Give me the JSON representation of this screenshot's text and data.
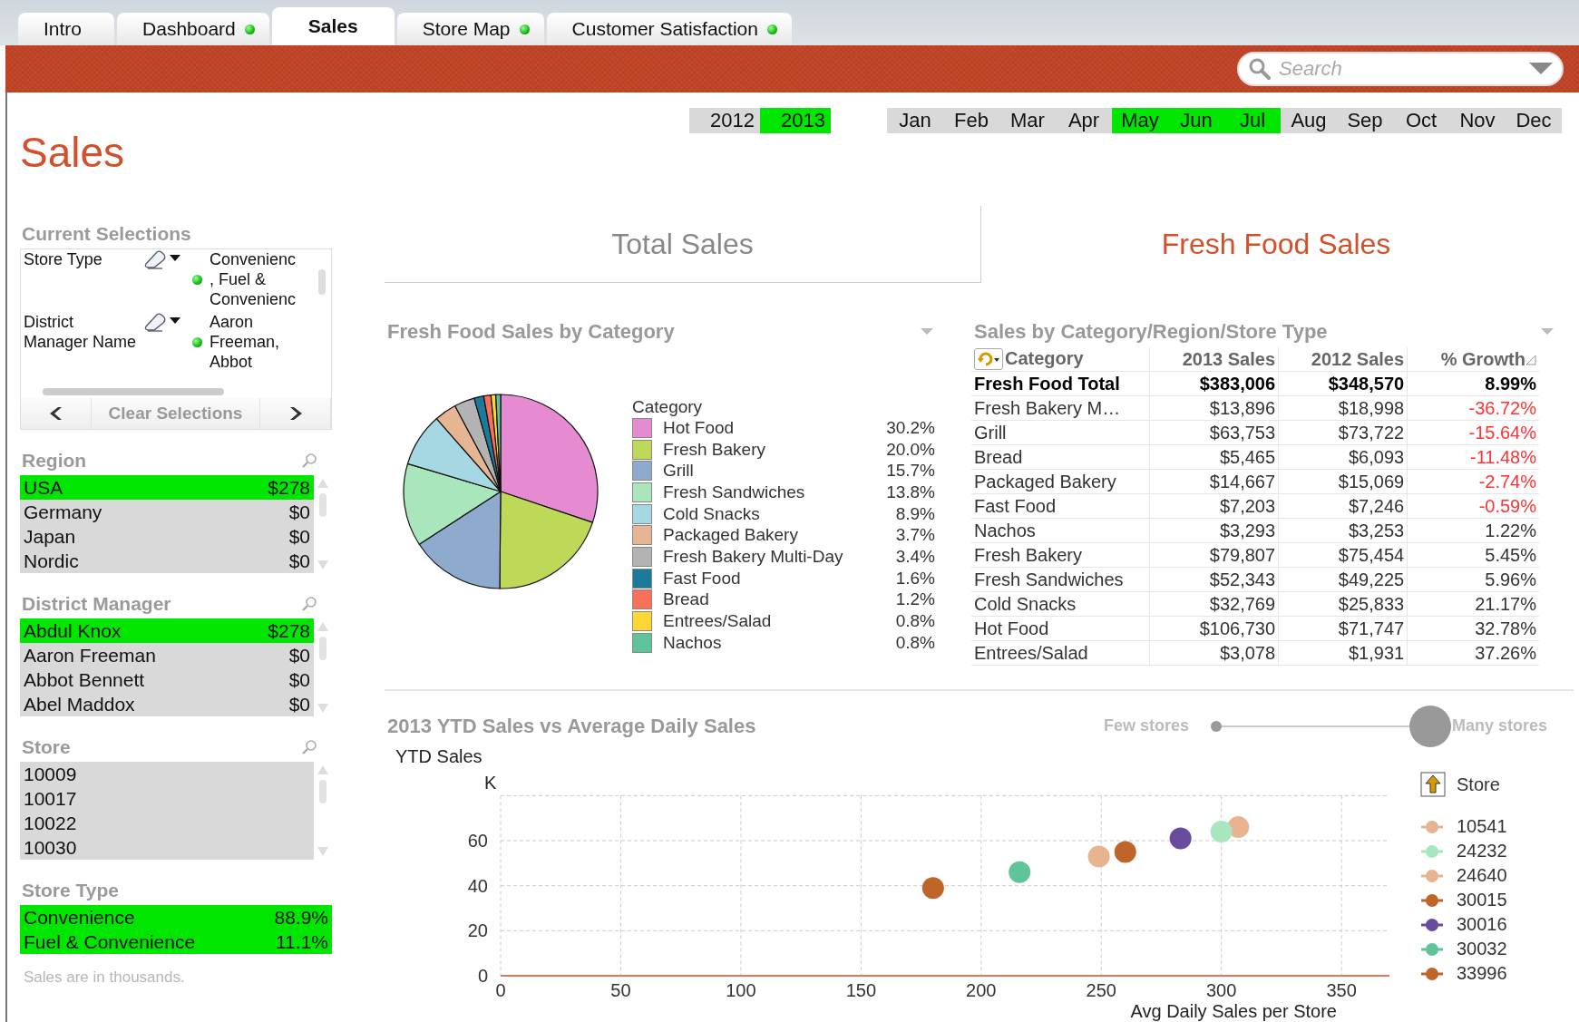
{
  "tabs": [
    {
      "label": "Intro",
      "selected": false,
      "dot": false
    },
    {
      "label": "Dashboard",
      "selected": false,
      "dot": true
    },
    {
      "label": "Sales",
      "selected": true,
      "dot": false
    },
    {
      "label": "Store Map",
      "selected": false,
      "dot": true
    },
    {
      "label": "Customer Satisfaction",
      "selected": false,
      "dot": true
    }
  ],
  "search": {
    "placeholder": "Search"
  },
  "page_title": "Sales",
  "years": [
    {
      "label": "2012",
      "selected": false
    },
    {
      "label": "2013",
      "selected": true
    }
  ],
  "months": [
    {
      "label": "Jan",
      "selected": false
    },
    {
      "label": "Feb",
      "selected": false
    },
    {
      "label": "Mar",
      "selected": false
    },
    {
      "label": "Apr",
      "selected": false
    },
    {
      "label": "May",
      "selected": true
    },
    {
      "label": "Jun",
      "selected": true
    },
    {
      "label": "Jul",
      "selected": true
    },
    {
      "label": "Aug",
      "selected": false
    },
    {
      "label": "Sep",
      "selected": false
    },
    {
      "label": "Oct",
      "selected": false
    },
    {
      "label": "Nov",
      "selected": false
    },
    {
      "label": "Dec",
      "selected": false
    }
  ],
  "current_selections": {
    "title": "Current Selections",
    "entries": [
      {
        "field": "Store Type",
        "values": [
          "Convenienc",
          ", Fuel &",
          "Convenienc"
        ]
      },
      {
        "field": "District Manager Name",
        "values": [
          "Aaron",
          "Freeman,",
          "Abbot"
        ]
      }
    ],
    "clear_button": "Clear Selections"
  },
  "list_boxes": [
    {
      "title": "Region",
      "kind": "scroll",
      "items": [
        {
          "label": "USA",
          "value": "$278",
          "selected": true
        },
        {
          "label": "Germany",
          "value": "$0",
          "selected": false
        },
        {
          "label": "Japan",
          "value": "$0",
          "selected": false
        },
        {
          "label": "Nordic",
          "value": "$0",
          "selected": false
        }
      ]
    },
    {
      "title": "District Manager",
      "kind": "scroll",
      "items": [
        {
          "label": "Abdul Knox",
          "value": "$278",
          "selected": true
        },
        {
          "label": "Aaron Freeman",
          "value": "$0",
          "selected": false
        },
        {
          "label": "Abbot Bennett",
          "value": "$0",
          "selected": false
        },
        {
          "label": "Abel Maddox",
          "value": "$0",
          "selected": false
        }
      ]
    },
    {
      "title": "Store",
      "kind": "scroll",
      "items": [
        {
          "label": "10009",
          "selected": false
        },
        {
          "label": "10017",
          "selected": false
        },
        {
          "label": "10022",
          "selected": false
        },
        {
          "label": "10030",
          "selected": false
        }
      ]
    },
    {
      "title": "Store Type",
      "kind": "plain",
      "items": [
        {
          "label": "Convenience",
          "value": "88.9%",
          "selected": true
        },
        {
          "label": "Fuel & Convenience",
          "value": "11.1%",
          "selected": true
        }
      ]
    }
  ],
  "footnote": "Sales are in thousands.",
  "sheet_tabs": [
    {
      "label": "Total Sales",
      "selected": false
    },
    {
      "label": "Fresh Food Sales",
      "selected": true
    }
  ],
  "pie": {
    "chart_data": {
      "type": "pie",
      "title": "Fresh Food Sales by Category",
      "categories": [
        "Hot Food",
        "Fresh Bakery",
        "Grill",
        "Fresh Sandwiches",
        "Cold Snacks",
        "Packaged Bakery",
        "Fresh Bakery Multi-Day",
        "Fast Food",
        "Bread",
        "Entrees/Salad",
        "Nachos"
      ],
      "series": [
        {
          "values": [
            30.2,
            20.0,
            15.7,
            13.8,
            8.9,
            3.7,
            3.4,
            1.6,
            1.2,
            0.8,
            0.8
          ]
        }
      ],
      "colors": [
        "#e68bd1",
        "#bdd957",
        "#8eaacc",
        "#a9e6bb",
        "#a6d8e3",
        "#e6b593",
        "#b3b3b3",
        "#1c7a9b",
        "#f87058",
        "#fdd835",
        "#5fc49a"
      ],
      "value_labels": [
        "30.2%",
        "20.0%",
        "15.7%",
        "13.8%",
        "8.9%",
        "3.7%",
        "3.4%",
        "1.6%",
        "1.2%",
        "0.8%",
        "0.8%"
      ],
      "legend": {
        "title": "Category"
      }
    }
  },
  "table": {
    "title": "Sales by Category/Region/Store Type",
    "columns": [
      "Category",
      "2013 Sales",
      "2012 Sales",
      "% Growth"
    ],
    "total": [
      "Fresh Food Total",
      "$383,006",
      "$348,570",
      "8.99%"
    ],
    "rows": [
      {
        "cells": [
          "Fresh Bakery M…",
          "$13,896",
          "$18,998",
          "-36.72%"
        ],
        "negative": true
      },
      {
        "cells": [
          "Grill",
          "$63,753",
          "$73,722",
          "-15.64%"
        ],
        "negative": true
      },
      {
        "cells": [
          "Bread",
          "$5,465",
          "$6,093",
          "-11.48%"
        ],
        "negative": true
      },
      {
        "cells": [
          "Packaged Bakery",
          "$14,667",
          "$15,069",
          "-2.74%"
        ],
        "negative": true
      },
      {
        "cells": [
          "Fast Food",
          "$7,203",
          "$7,246",
          "-0.59%"
        ],
        "negative": true
      },
      {
        "cells": [
          "Nachos",
          "$3,293",
          "$3,253",
          "1.22%"
        ],
        "negative": false
      },
      {
        "cells": [
          "Fresh Bakery",
          "$79,807",
          "$75,454",
          "5.45%"
        ],
        "negative": false
      },
      {
        "cells": [
          "Fresh Sandwiches",
          "$52,343",
          "$49,225",
          "5.96%"
        ],
        "negative": false
      },
      {
        "cells": [
          "Cold Snacks",
          "$32,769",
          "$25,833",
          "21.17%"
        ],
        "negative": false
      },
      {
        "cells": [
          "Hot Food",
          "$106,730",
          "$71,747",
          "32.78%"
        ],
        "negative": false
      },
      {
        "cells": [
          "Entrees/Salad",
          "$3,078",
          "$1,931",
          "37.26%"
        ],
        "negative": false
      }
    ]
  },
  "scatter": {
    "size_legend": {
      "min_label": "Few stores",
      "max_label": "Many stores"
    },
    "chart_data": {
      "type": "scatter",
      "title": "2013 YTD Sales vs Average Daily Sales",
      "xlabel": "Avg Daily Sales per Store",
      "ylabel": "YTD Sales",
      "annotations": [
        {
          "text": "K"
        }
      ],
      "legend": {
        "title": "Store"
      },
      "grid": true,
      "x": [
        180,
        216,
        249,
        260,
        283,
        300,
        307
      ],
      "series": [
        {
          "name": "10541",
          "color": "#e8b48f",
          "values": [
            null,
            null,
            null,
            null,
            null,
            null,
            66
          ]
        },
        {
          "name": "24232",
          "color": "#a8e6bf",
          "values": [
            null,
            null,
            null,
            null,
            null,
            64,
            null
          ]
        },
        {
          "name": "24640",
          "color": "#e8b48f",
          "values": [
            null,
            null,
            53,
            null,
            null,
            null,
            null
          ]
        },
        {
          "name": "30015",
          "color": "#c0652a",
          "values": [
            39,
            null,
            null,
            null,
            null,
            null,
            null
          ]
        },
        {
          "name": "30016",
          "color": "#6a4c9c",
          "values": [
            null,
            null,
            null,
            null,
            61,
            null,
            null
          ]
        },
        {
          "name": "30032",
          "color": "#5fc49a",
          "values": [
            null,
            46,
            null,
            null,
            null,
            null,
            null
          ]
        },
        {
          "name": "33996",
          "color": "#c0652a",
          "values": [
            null,
            null,
            null,
            55,
            null,
            null,
            null
          ]
        }
      ],
      "xlim": [
        0,
        370
      ],
      "ylim": [
        0,
        80
      ],
      "xticks": [
        0,
        50,
        100,
        150,
        200,
        250,
        300,
        350
      ],
      "yticks": [
        0,
        20,
        40,
        60
      ]
    }
  }
}
